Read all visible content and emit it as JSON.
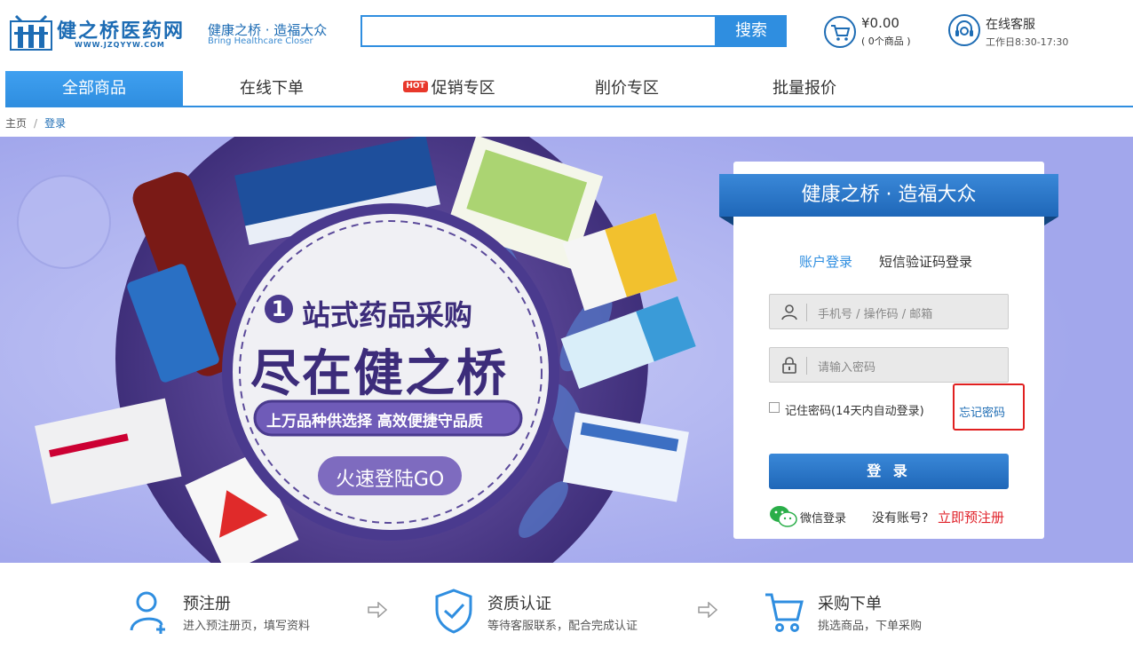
{
  "header": {
    "logo_text": "健之桥医药网",
    "logo_sub": "WWW.JZQYYW.COM",
    "slogan_cn": "健康之桥 · 造福大众",
    "slogan_en": "Bring  Healthcare  Closer",
    "search_value": "",
    "search_button": "搜索",
    "cart_amount": "¥0.00",
    "cart_count": "( 0个商品 )",
    "service_title": "在线客服",
    "service_hours": "工作日8:30-17:30"
  },
  "nav": {
    "items": [
      {
        "label": "全部商品"
      },
      {
        "label": "在线下单"
      },
      {
        "label": "促销专区",
        "badge": "HOT"
      },
      {
        "label": "削价专区"
      },
      {
        "label": "批量报价"
      }
    ]
  },
  "breadcrumb": {
    "home": "主页",
    "sep": "/",
    "current": "登录"
  },
  "banner": {
    "headline_1": "站式药品采购",
    "headline_num": "1",
    "headline_2": "尽在健之桥",
    "tagline": "上万品种供选择 高效便捷守品质",
    "cta": "火速登陆GO",
    "colors": {
      "bg": "#a7acee",
      "circle": "#5b4a9a",
      "accent": "#6c55b0"
    }
  },
  "login": {
    "ribbon": "健康之桥 · 造福大众",
    "tab_account": "账户登录",
    "tab_sms": "短信验证码登录",
    "username_placeholder": "手机号 / 操作码 / 邮箱",
    "password_placeholder": "请输入密码",
    "remember_label": "记住密码(14天内自动登录)",
    "forgot_label": "忘记密码",
    "login_button": "登 录",
    "wechat_label": "微信登录",
    "no_account": "没有账号?",
    "register_link": "立即预注册"
  },
  "steps": [
    {
      "title": "预注册",
      "desc": "进入预注册页，填写资料",
      "icon": "user-add-icon"
    },
    {
      "title": "资质认证",
      "desc": "等待客服联系，配合完成认证",
      "icon": "shield-check-icon"
    },
    {
      "title": "采购下单",
      "desc": "挑选商品，下单采购",
      "icon": "cart-icon"
    }
  ]
}
